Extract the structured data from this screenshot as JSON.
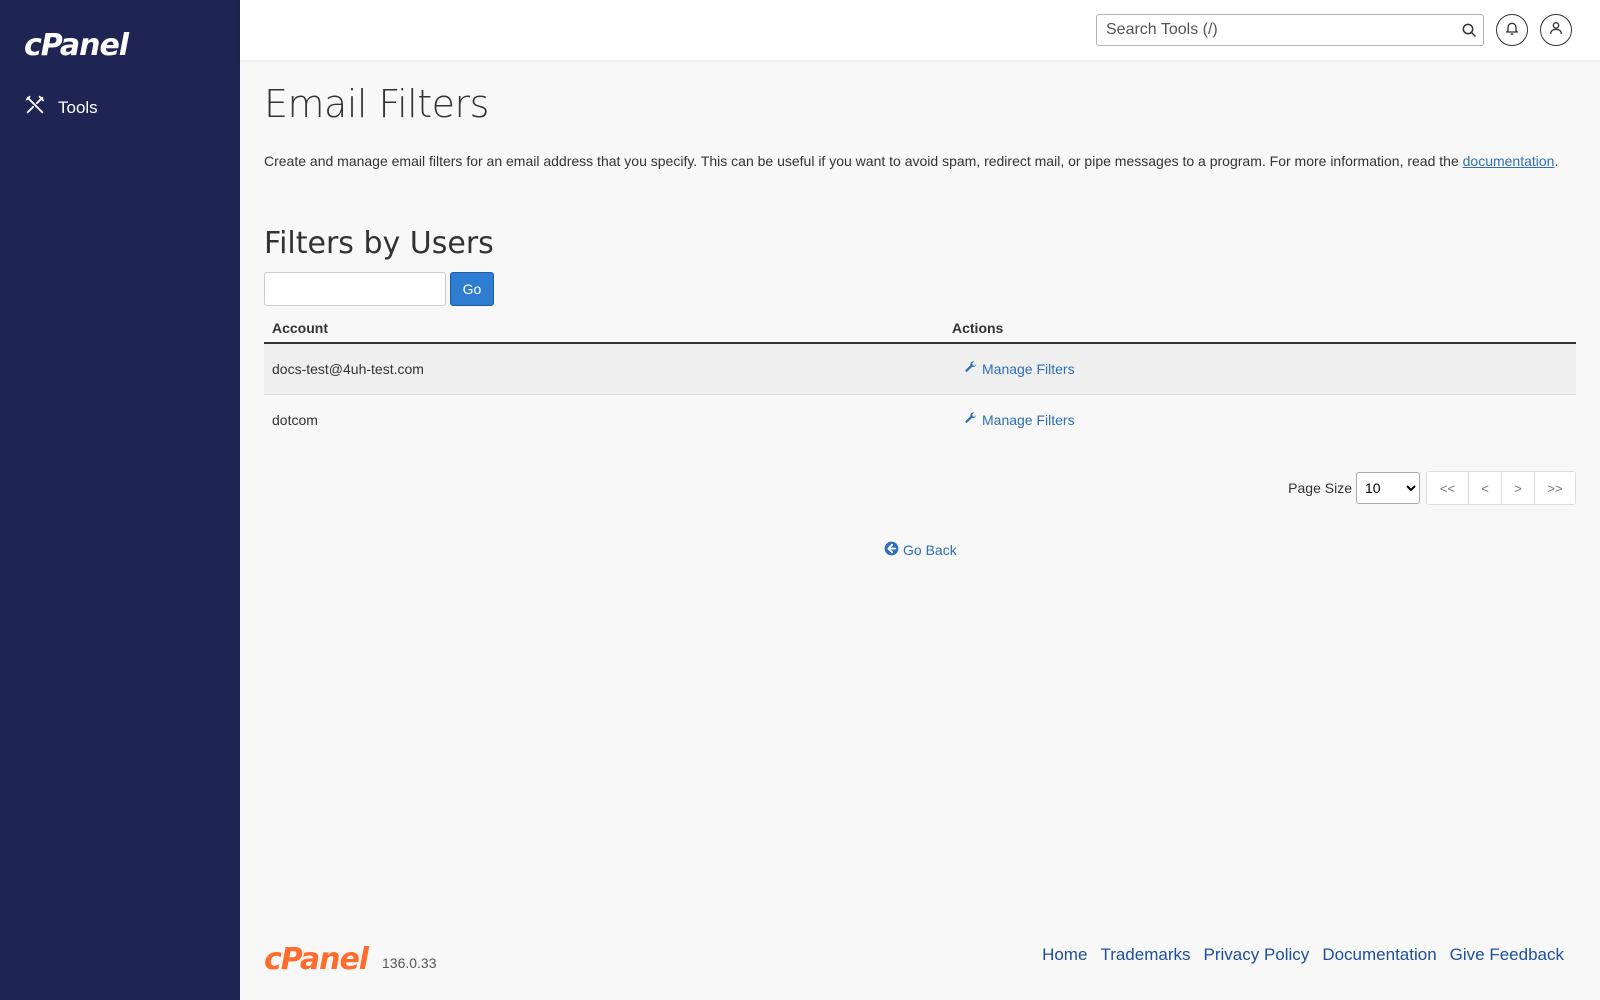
{
  "sidebar": {
    "logo": "cPanel",
    "items": [
      {
        "label": "Tools",
        "icon": "tools-icon"
      }
    ]
  },
  "topbar": {
    "search_placeholder": "Search Tools (/)",
    "search_value": ""
  },
  "main": {
    "title": "Email Filters",
    "description": "Create and manage email filters for an email address that you specify. This can be useful if you want to avoid spam, redirect mail, or pipe messages to a program. For more information, read the",
    "doc_link": "documentation",
    "doc_suffix": ".",
    "section_title": "Filters by Users",
    "filter_value": "",
    "go_label": "Go",
    "table": {
      "headers": [
        "Account",
        "Actions"
      ],
      "rows": [
        {
          "account": "docs-test@4uh-test.com",
          "action": "Manage Filters"
        },
        {
          "account": "dotcom",
          "action": "Manage Filters"
        }
      ]
    },
    "pager": {
      "page_size_label": "Page Size",
      "page_size": "10",
      "buttons": [
        "<<",
        "<",
        ">",
        ">>"
      ]
    },
    "go_back": "Go Back"
  },
  "footer": {
    "logo": "cPanel",
    "version": "136.0.33",
    "links": [
      "Home",
      "Trademarks",
      "Privacy Policy",
      "Documentation",
      "Give Feedback"
    ]
  },
  "colors": {
    "sidebar_bg": "#1f2552",
    "link": "#2f6fb8",
    "primary_button": "#2f7dd1",
    "footer_logo": "#ff6c2c"
  }
}
